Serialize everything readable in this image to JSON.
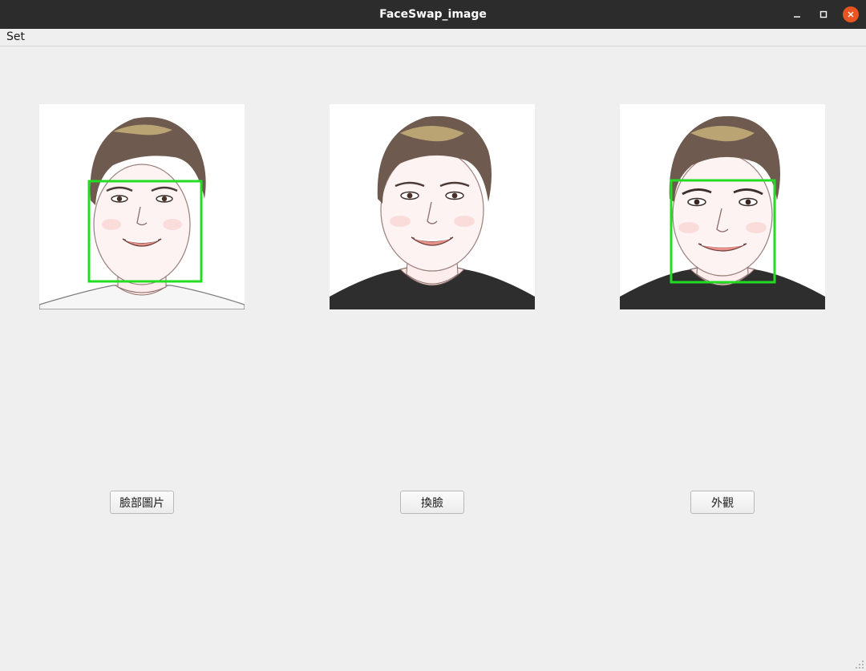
{
  "window": {
    "title": "FaceSwap_image"
  },
  "menu": {
    "items": [
      {
        "label": "Set"
      }
    ]
  },
  "panels": [
    {
      "name": "source-face",
      "has_detection_box": true
    },
    {
      "name": "swapped-result",
      "has_detection_box": false
    },
    {
      "name": "target-appearance",
      "has_detection_box": true
    }
  ],
  "buttons": {
    "face_image": "臉部圖片",
    "swap_face": "換臉",
    "appearance": "外觀"
  },
  "colors": {
    "titlebar": "#2c2c2c",
    "close_button": "#e95420",
    "detection_box": "#22dd22",
    "background": "#efefef"
  }
}
